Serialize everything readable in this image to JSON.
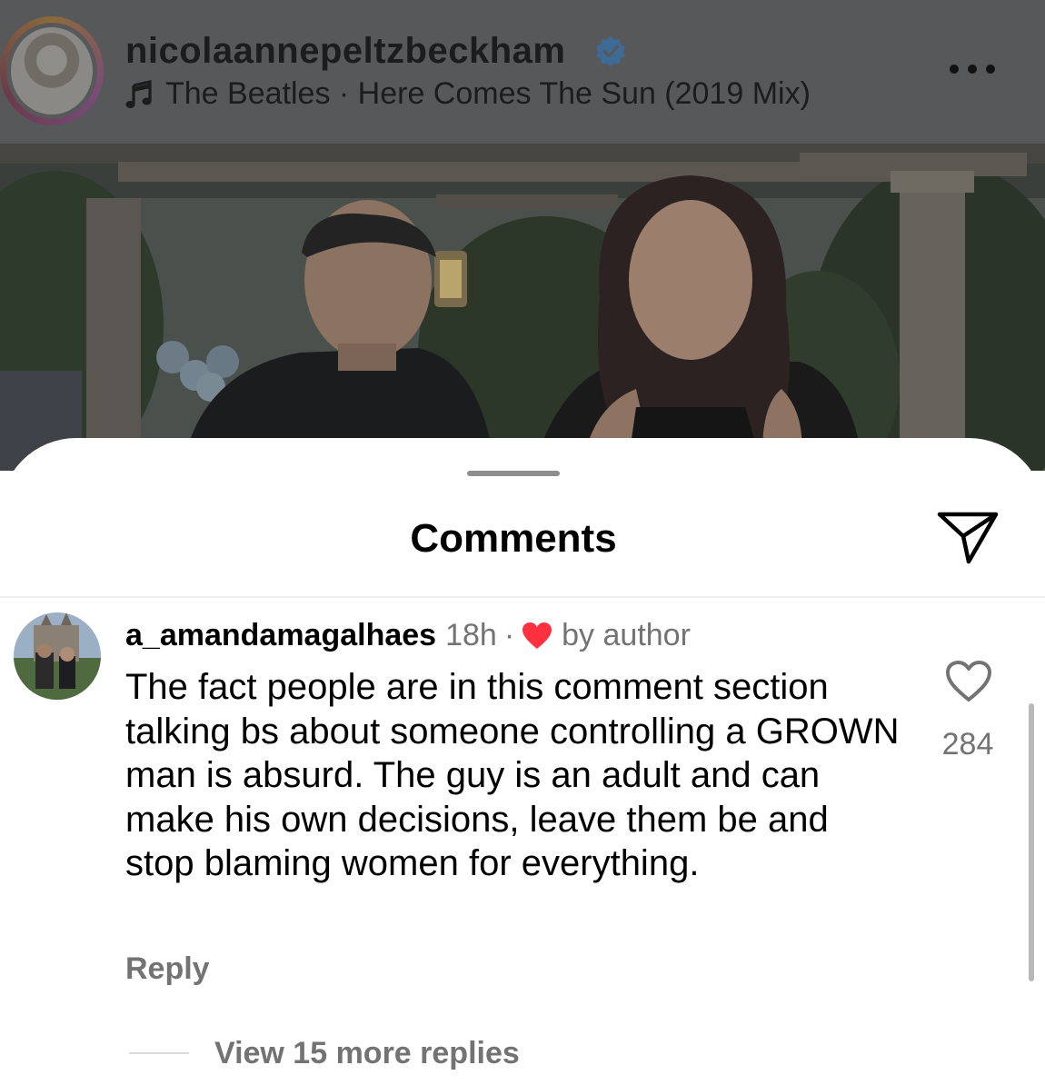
{
  "post": {
    "username": "nicolaannepeltzbeckham",
    "music": "The Beatles · Here Comes The Sun (2019 Mix)"
  },
  "comments_sheet": {
    "title": "Comments",
    "comment": {
      "username": "a_amandamagalhaes",
      "time": "18h",
      "separator": "·",
      "liked_by": "by author",
      "text": "The fact people are in this comment section talking bs about someone controlling a GROWN man is absurd. The guy is an adult and can make his own decisions, leave them be and stop blaming women for everything.",
      "like_count": "284",
      "reply_label": "Reply",
      "view_replies_label": "View 15 more replies"
    }
  },
  "icons": {
    "verified": "verified-badge-icon",
    "music": "music-note-icon",
    "more": "more-options-icon",
    "share": "send-icon",
    "liked": "heart-filled-icon",
    "like": "heart-outline-icon"
  },
  "colors": {
    "verified_blue": "#0095f6",
    "liked_red": "#ff3040",
    "secondary_text": "#737373"
  }
}
